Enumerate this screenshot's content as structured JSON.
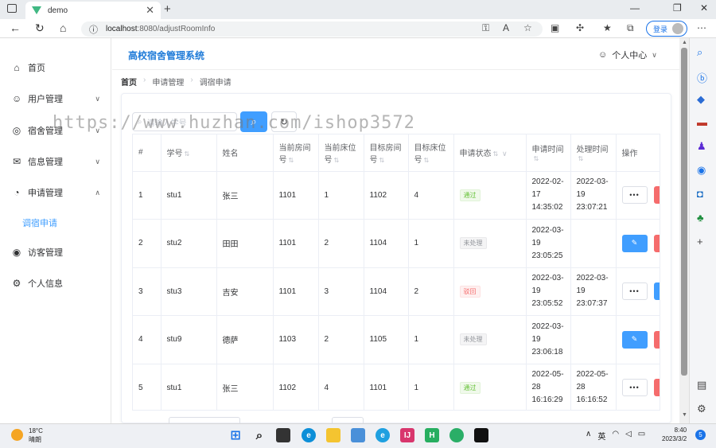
{
  "browser": {
    "tab_title": "demo",
    "tab_close": "✕",
    "new_tab": "+",
    "url_host": "localhost",
    "url_path": ":8080/adjustRoomInfo",
    "login_label": "登录"
  },
  "app": {
    "title": "高校宿舍管理系统",
    "user_menu_label": "个人中心"
  },
  "sidebar": {
    "items": [
      {
        "label": "首页",
        "icon": "home-icon"
      },
      {
        "label": "用户管理",
        "icon": "user-icon"
      },
      {
        "label": "宿舍管理",
        "icon": "building-icon"
      },
      {
        "label": "信息管理",
        "icon": "mail-icon"
      },
      {
        "label": "申请管理",
        "icon": "pie-icon"
      },
      {
        "label": "调宿申请",
        "icon": ""
      },
      {
        "label": "访客管理",
        "icon": "eye-icon"
      },
      {
        "label": "个人信息",
        "icon": "gear-icon"
      }
    ]
  },
  "breadcrumb": [
    "首页",
    "申请管理",
    "调宿申请"
  ],
  "search": {
    "placeholder": "请输入学号"
  },
  "table": {
    "headers": [
      "#",
      "学号",
      "姓名",
      "当前房间号",
      "当前床位号",
      "目标房间号",
      "目标床位号",
      "申请状态",
      "申请时间",
      "处理时间",
      "操作"
    ],
    "rows": [
      {
        "idx": "1",
        "sid": "stu1",
        "name": "张三",
        "cur_room": "1101",
        "cur_bed": "1",
        "tgt_room": "1102",
        "tgt_bed": "4",
        "status": "通过",
        "apply_time": "2022-02-17 14:35:02",
        "handle_time": "2022-03-19 23:07:21"
      },
      {
        "idx": "2",
        "sid": "stu2",
        "name": "田田",
        "cur_room": "1101",
        "cur_bed": "2",
        "tgt_room": "1104",
        "tgt_bed": "1",
        "status": "未处理",
        "apply_time": "2022-03-19 23:05:25",
        "handle_time": ""
      },
      {
        "idx": "3",
        "sid": "stu3",
        "name": "吉安",
        "cur_room": "1101",
        "cur_bed": "3",
        "tgt_room": "1104",
        "tgt_bed": "2",
        "status": "驳回",
        "apply_time": "2022-03-19 23:05:52",
        "handle_time": "2022-03-19 23:07:37"
      },
      {
        "idx": "4",
        "sid": "stu9",
        "name": "德萨",
        "cur_room": "1103",
        "cur_bed": "2",
        "tgt_room": "1105",
        "tgt_bed": "1",
        "status": "未处理",
        "apply_time": "2022-03-19 23:06:18",
        "handle_time": ""
      },
      {
        "idx": "5",
        "sid": "stu1",
        "name": "张三",
        "cur_room": "1102",
        "cur_bed": "4",
        "tgt_room": "1101",
        "tgt_bed": "1",
        "status": "通过",
        "apply_time": "2022-05-28 16:16:29",
        "handle_time": "2022-05-28 16:16:52"
      }
    ]
  },
  "watermark": "https://www.huzhan.com/ishop3572",
  "taskbar": {
    "temp": "18°C",
    "weather": "晴朗",
    "ime": "英",
    "time": "8:40",
    "date": "2023/3/2",
    "notifications": "5"
  },
  "colors": {
    "primary": "#409eff",
    "danger": "#f56c6c",
    "success": "#67c23a",
    "title": "#1f7bd8"
  }
}
